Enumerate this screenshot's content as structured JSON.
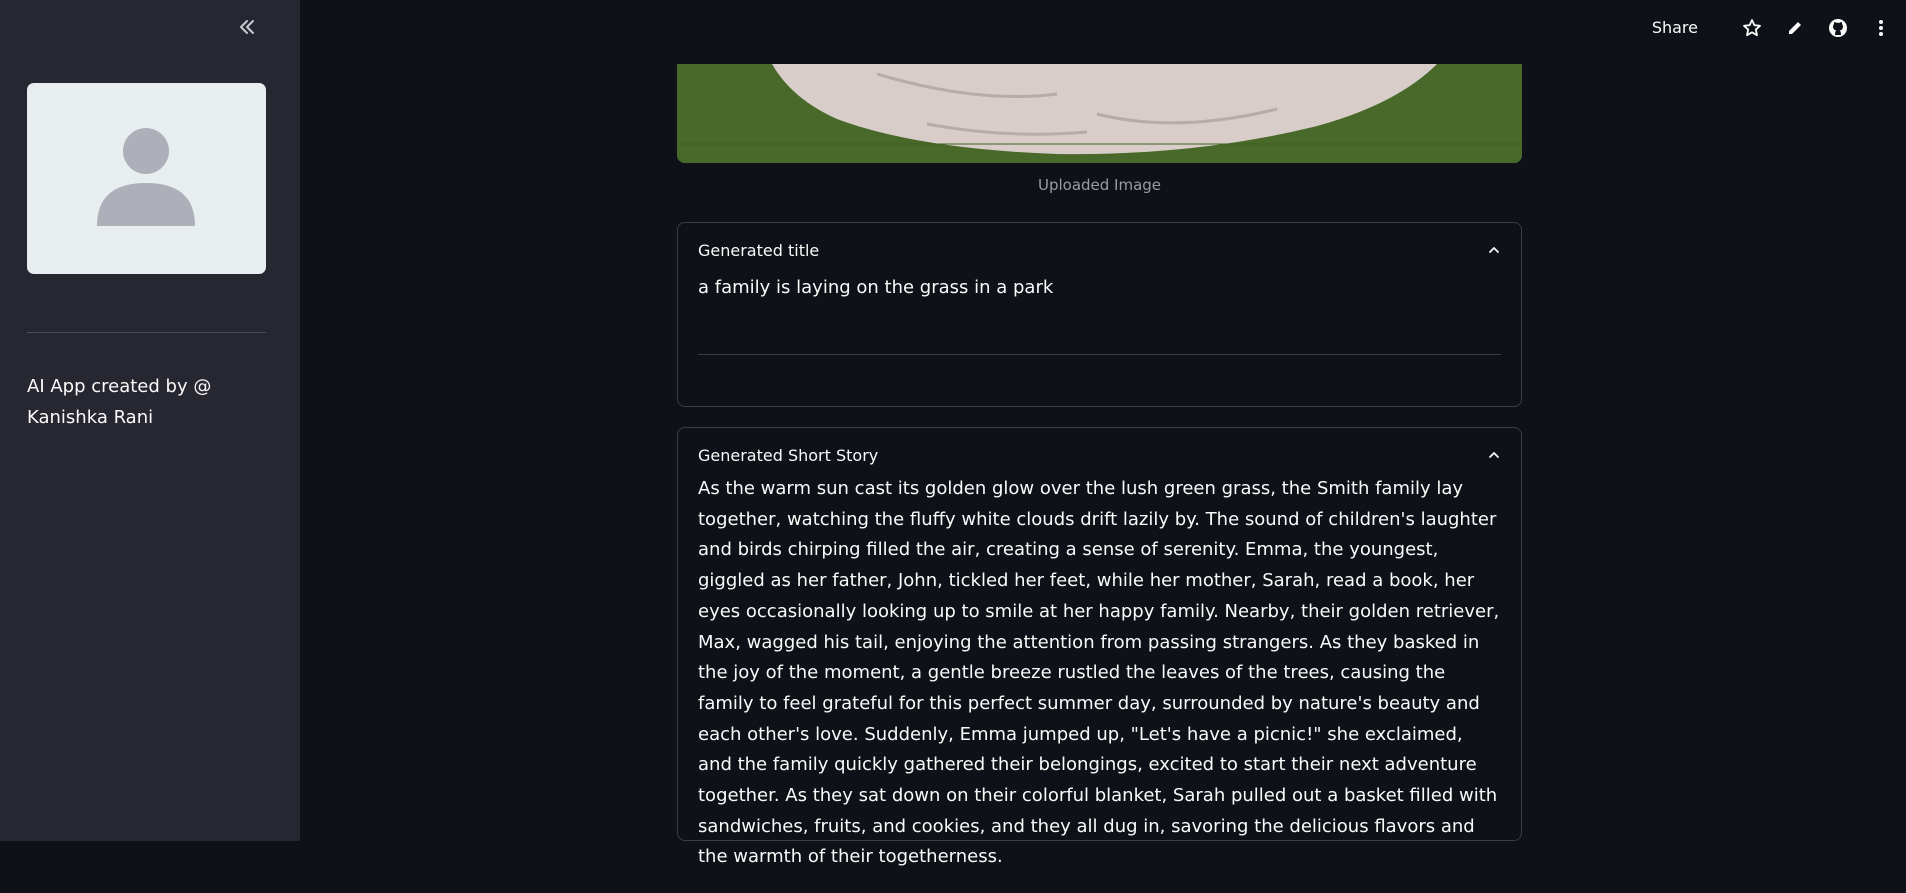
{
  "sidebar": {
    "collapse_icon": "double-chevron-left-icon",
    "avatar_icon": "person-placeholder-icon",
    "credit": "AI App created by @ Kanishka Rani"
  },
  "header": {
    "share_label": "Share",
    "icons": [
      "star-icon",
      "pencil-icon",
      "github-icon",
      "kebab-menu-icon"
    ]
  },
  "main": {
    "image_caption": "Uploaded Image",
    "title_section": {
      "label": "Generated title",
      "text": "a family is laying on the grass in a park"
    },
    "story_section": {
      "label": "Generated Short Story",
      "text": "As the warm sun cast its golden glow over the lush green grass, the Smith family lay together, watching the fluffy white clouds drift lazily by. The sound of children's laughter and birds chirping filled the air, creating a sense of serenity. Emma, the youngest, giggled as her father, John, tickled her feet, while her mother, Sarah, read a book, her eyes occasionally looking up to smile at her happy family. Nearby, their golden retriever, Max, wagged his tail, enjoying the attention from passing strangers. As they basked in the joy of the moment, a gentle breeze rustled the leaves of the trees, causing the family to feel grateful for this perfect summer day, surrounded by nature's beauty and each other's love. Suddenly, Emma jumped up, \"Let's have a picnic!\" she exclaimed, and the family quickly gathered their belongings, excited to start their next adventure together. As they sat down on their colorful blanket, Sarah pulled out a basket filled with sandwiches, fruits, and cookies, and they all dug in, savoring the delicious flavors and the warmth of their togetherness."
    }
  },
  "colors": {
    "background": "#0e1117",
    "sidebar": "#262730",
    "text": "#fafafa",
    "muted": "#9a9ca3",
    "border": "#3a3d46"
  }
}
